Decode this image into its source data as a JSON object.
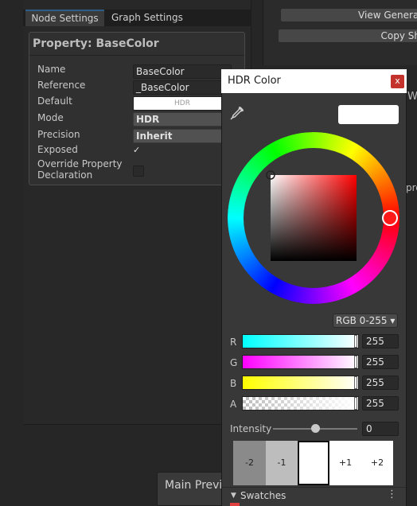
{
  "inspector": {
    "tabs": [
      "Node Settings",
      "Graph Settings"
    ],
    "title": "Property: BaseColor",
    "fields": {
      "name_label": "Name",
      "name_value": "BaseColor",
      "reference_label": "Reference",
      "reference_value": "_BaseColor",
      "default_label": "Default",
      "default_value": "HDR",
      "mode_label": "Mode",
      "mode_value": "HDR",
      "precision_label": "Precision",
      "precision_value": "Inherit",
      "exposed_label": "Exposed",
      "exposed_check": "✓",
      "override_label_1": "Override Property",
      "override_label_2": "Declaration"
    }
  },
  "right_panel": {
    "view_generated": "View Generat",
    "copy_shader": "Copy Sh",
    "w_text": "W",
    "pre_text": "pre"
  },
  "main_preview": {
    "label": "Main Previ"
  },
  "hdr_color": {
    "title": "HDR Color",
    "close": "x",
    "mode": "RGB 0-255 ▾",
    "channels": [
      {
        "label": "R",
        "value": "255"
      },
      {
        "label": "G",
        "value": "255"
      },
      {
        "label": "B",
        "value": "255"
      },
      {
        "label": "A",
        "value": "255"
      }
    ],
    "intensity_label": "Intensity",
    "intensity_value": "0",
    "intensity_fraction": 0.5,
    "exposure": [
      "-2",
      "-1",
      "",
      "+1",
      "+2"
    ],
    "swatches_label": "Swatches",
    "swatches_arrow": "▼",
    "swatches_menu": "⋮",
    "color": "#ffffff"
  }
}
